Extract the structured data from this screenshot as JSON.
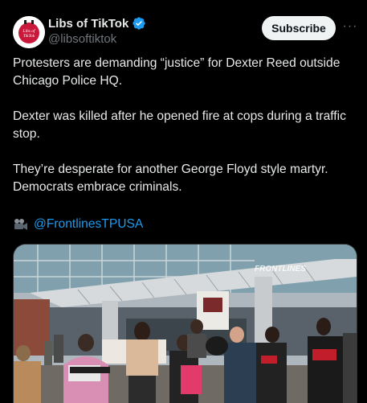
{
  "account": {
    "display_name": "Libs of TikTok",
    "handle": "@libsoftiktok",
    "avatar_text": "Libs of TikTok",
    "verified": true
  },
  "actions": {
    "subscribe_label": "Subscribe",
    "more_label": "···"
  },
  "post": {
    "paragraphs": [
      "Protesters are demanding “justice” for Dexter Reed outside Chicago Police HQ.",
      "Dexter was killed after he opened fire at cops during a traffic stop.",
      "They’re desperate for another George Floyd style martyr. Democrats embrace criminals."
    ],
    "credit_icon": "video-camera-icon",
    "credit_link": "@FrontlinesTPUSA"
  },
  "media": {
    "watermark": "FRONTLINES"
  },
  "colors": {
    "background": "#000000",
    "text": "#e7e9ea",
    "muted": "#71767b",
    "link": "#1d9bf0",
    "verified": "#1d9bf0",
    "subscribe_bg": "#eff3f4"
  }
}
